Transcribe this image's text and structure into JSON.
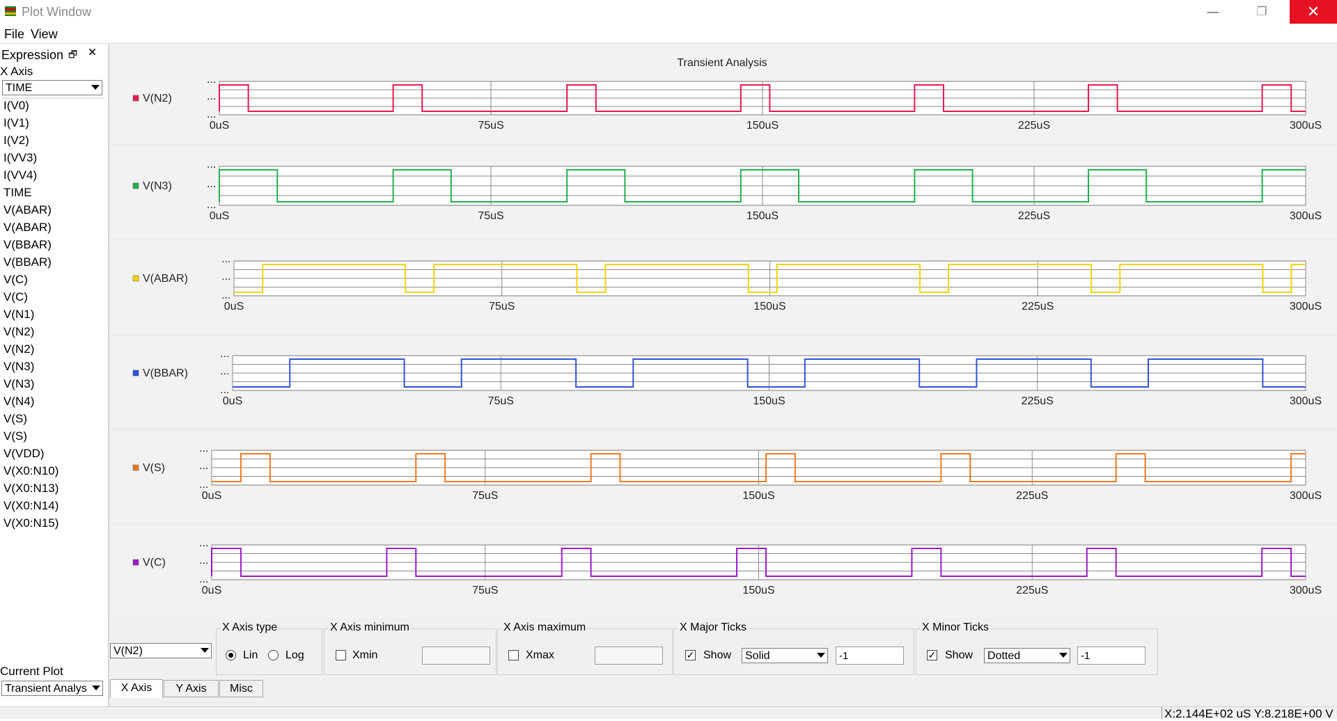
{
  "window": {
    "title": "Plot Window",
    "controls": {
      "minimize": "—",
      "maximize": "❐",
      "close": "✕"
    }
  },
  "menu": [
    "File",
    "View"
  ],
  "sidebar": {
    "expression_title": "Expression",
    "x_axis_label": "X Axis",
    "x_axis_value": "TIME",
    "variables": [
      "I(V0)",
      "I(V1)",
      "I(V2)",
      "I(VV3)",
      "I(VV4)",
      "TIME",
      "V(ABAR)",
      "V(ABAR)",
      "V(BBAR)",
      "V(BBAR)",
      "V(C)",
      "V(C)",
      "V(N1)",
      "V(N2)",
      "V(N2)",
      "V(N3)",
      "V(N3)",
      "V(N4)",
      "V(S)",
      "V(S)",
      "V(VDD)",
      "V(X0:N10)",
      "V(X0:N13)",
      "V(X0:N14)",
      "V(X0:N15)"
    ],
    "current_plot_label": "Current Plot",
    "current_plot_value": "Transient Analys"
  },
  "chart_data": {
    "type": "line",
    "title": "Transient Analysis",
    "xlim": [
      0,
      300
    ],
    "x_unit": "uS",
    "x_ticks": [
      "0uS",
      "75uS",
      "150uS",
      "225uS",
      "300uS"
    ],
    "y_tick_label": "...",
    "grid": true,
    "series": [
      {
        "name": "V(N2)",
        "color": "#e8174f",
        "kind": "pulse",
        "rise_at": [
          0,
          48,
          96,
          144,
          192,
          240,
          288
        ],
        "width": 8
      },
      {
        "name": "V(N3)",
        "color": "#22b04a",
        "kind": "pulse",
        "rise_at": [
          0,
          48,
          96,
          144,
          192,
          240,
          288
        ],
        "width": 16
      },
      {
        "name": "V(ABAR)",
        "color": "#f2d400",
        "kind": "square",
        "high_from": [
          8,
          56,
          104,
          152,
          200,
          248,
          296
        ],
        "high_to": [
          48,
          96,
          144,
          192,
          240,
          288,
          300
        ],
        "start_low": true
      },
      {
        "name": "V(BBAR)",
        "color": "#2f54d8",
        "kind": "square",
        "high_from": [
          16,
          64,
          112,
          160,
          208,
          256
        ],
        "high_to": [
          48,
          96,
          144,
          192,
          240,
          288
        ]
      },
      {
        "name": "V(S)",
        "color": "#f07a20",
        "kind": "pulse",
        "rise_at": [
          8,
          56,
          104,
          152,
          200,
          248,
          296
        ],
        "width": 8
      },
      {
        "name": "V(C)",
        "color": "#9b18c8",
        "kind": "pulse",
        "rise_at": [
          0,
          48,
          96,
          144,
          192,
          240,
          288
        ],
        "width": 8
      }
    ]
  },
  "bottom": {
    "signal_combo": "V(N2)",
    "x_axis_type": {
      "title": "X Axis type",
      "lin": "Lin",
      "log": "Log",
      "selected": "Lin"
    },
    "x_axis_min": {
      "title": "X Axis minimum",
      "check_label": "Xmin",
      "value": ""
    },
    "x_axis_max": {
      "title": "X Axis maximum",
      "check_label": "Xmax",
      "value": ""
    },
    "x_major": {
      "title": "X Major Ticks",
      "show": "Show",
      "style": "Solid",
      "count": "-1"
    },
    "x_minor": {
      "title": "X Minor Ticks",
      "show": "Show",
      "style": "Dotted",
      "count": "-1"
    },
    "tabs": [
      "X Axis",
      "Y Axis",
      "Misc"
    ],
    "active_tab": "X Axis"
  },
  "status": "X:2.144E+02 uS Y:8.218E+00 V"
}
